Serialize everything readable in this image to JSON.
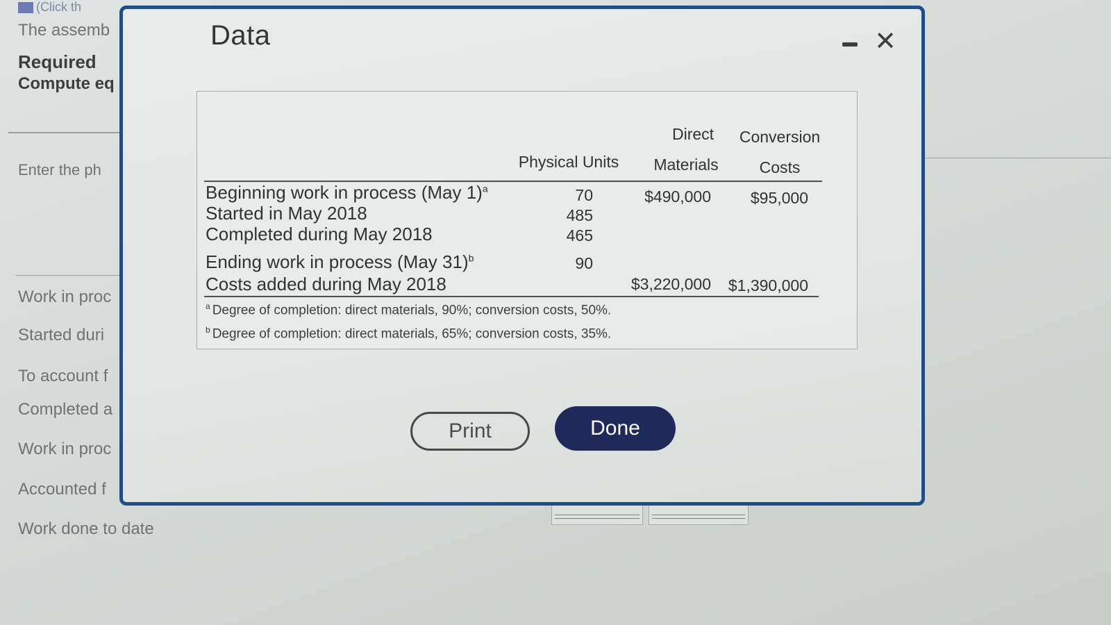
{
  "background": {
    "top_link": "(Click th",
    "intro": "The assemb",
    "required_heading": "Required",
    "compute_text": "Compute eq",
    "enter_text": "Enter the ph",
    "rows": [
      "Work in proc",
      "Started duri",
      "To account f",
      "Completed a",
      "Work in proc",
      "Accounted f",
      "Work done to date"
    ]
  },
  "modal": {
    "title": "Data",
    "minimize_icon": "minimize-icon",
    "close_icon": "close-icon",
    "close_glyph": "✕"
  },
  "table": {
    "headers": {
      "physical_units": "Physical Units",
      "direct_materials_line1": "Direct",
      "direct_materials_line2": "Materials",
      "conversion_line1": "Conversion",
      "conversion_line2": "Costs"
    },
    "rows": [
      {
        "label": "Beginning work in process (May 1)",
        "note": "a",
        "units": "70",
        "dm": "$490,000",
        "cc": "$95,000"
      },
      {
        "label": "Started in May 2018",
        "note": "",
        "units": "485",
        "dm": "",
        "cc": ""
      },
      {
        "label": "Completed during May 2018",
        "note": "",
        "units": "465",
        "dm": "",
        "cc": ""
      },
      {
        "label": "Ending work in process (May 31)",
        "note": "b",
        "units": "90",
        "dm": "",
        "cc": ""
      },
      {
        "label": "Costs added during May 2018",
        "note": "",
        "units": "",
        "dm": "$3,220,000",
        "cc": "$1,390,000"
      }
    ],
    "footnotes": [
      {
        "mark": "a",
        "text": "Degree of completion: direct materials, 90%; conversion costs, 50%."
      },
      {
        "mark": "b",
        "text": "Degree of completion: direct materials, 65%; conversion costs, 35%."
      }
    ]
  },
  "buttons": {
    "print": "Print",
    "done": "Done"
  },
  "colors": {
    "modal_border": "#1d4e8a",
    "done_bg": "#1f2a5a"
  }
}
